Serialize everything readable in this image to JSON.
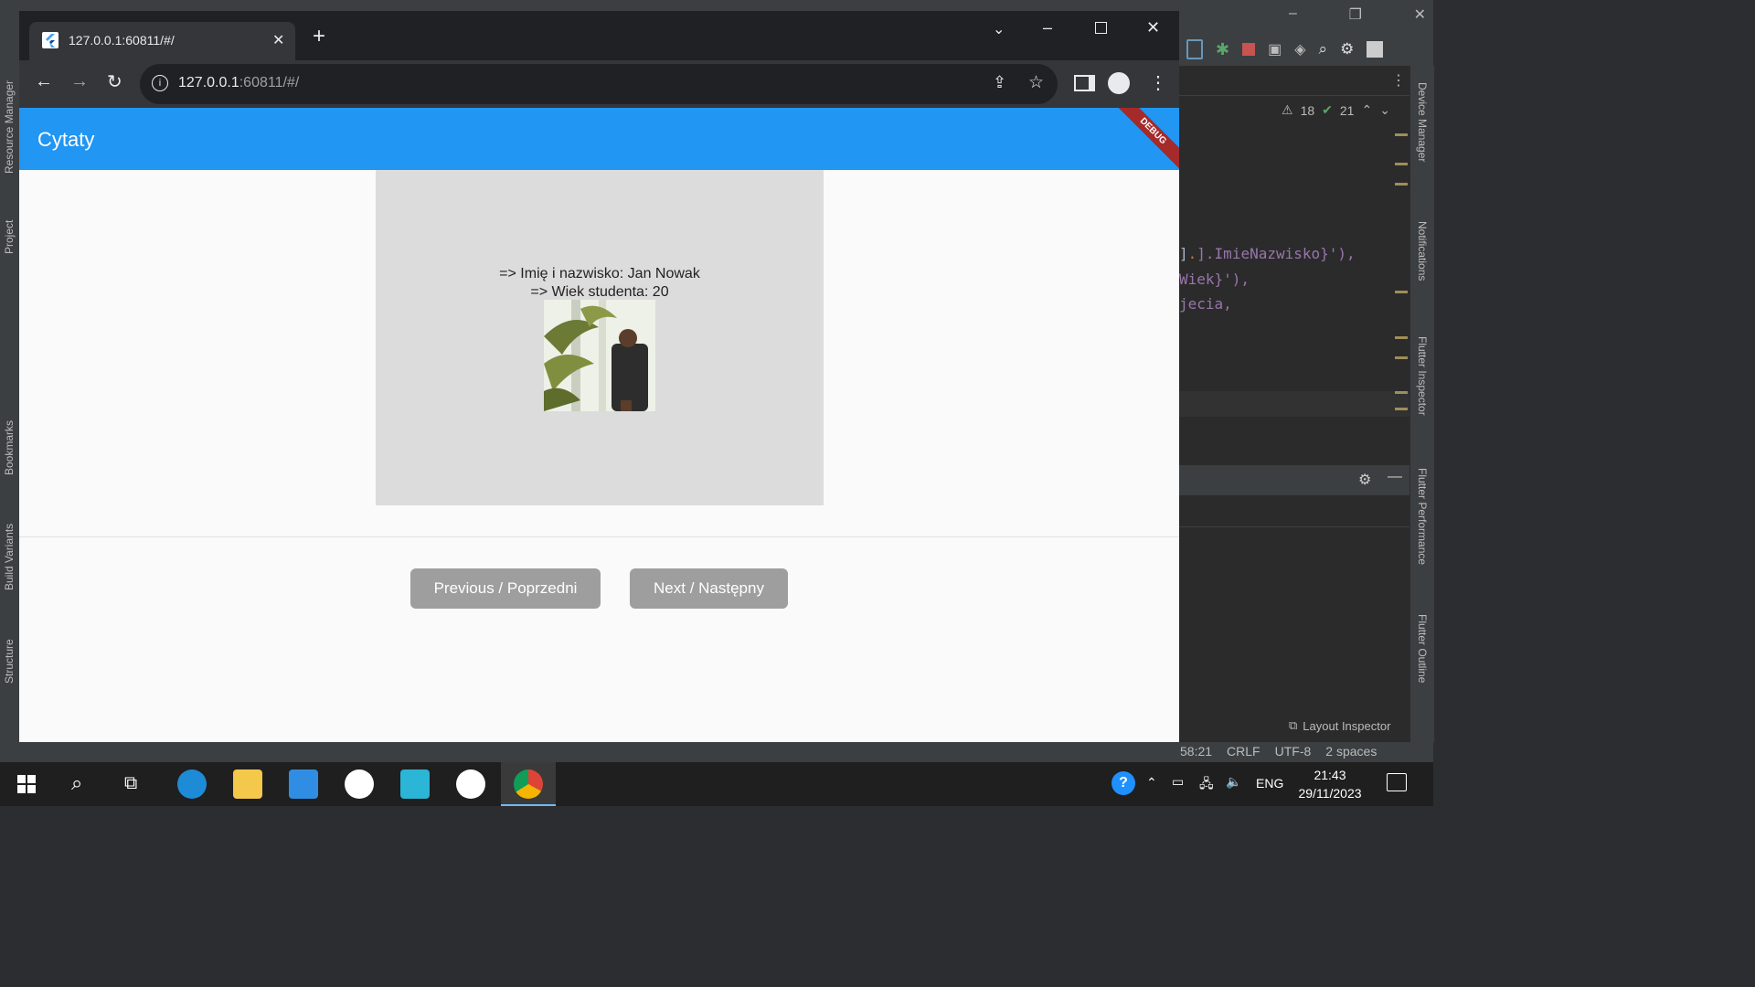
{
  "browser": {
    "tab_title": "127.0.0.1:60811/#/",
    "url_host": "127.0.0.1",
    "url_rest": ":60811/#/"
  },
  "app": {
    "title": "Cytaty",
    "debug_banner": "DEBUG",
    "name_line": "=> Imię i nazwisko: Jan Nowak",
    "age_line": "=> Wiek studenta: 20",
    "prev_label": "Previous / Poprzedni",
    "next_label": "Next / Następny"
  },
  "ide": {
    "left_panels": [
      "Resource Manager",
      "Project",
      "Bookmarks",
      "Build Variants",
      "Structure"
    ],
    "right_panels": [
      "Device Manager",
      "Notifications",
      "Flutter Inspector",
      "Flutter Performance",
      "Flutter Outline"
    ],
    "warnings": "18",
    "checks": "21",
    "code_lines": [
      "].ImieNazwisko}'),",
      "Wiek}'),",
      "jecia,"
    ],
    "layout_inspector": "Layout Inspector",
    "status": {
      "position": "58:21",
      "line_sep": "CRLF",
      "encoding": "UTF-8",
      "indent": "2 spaces"
    }
  },
  "taskbar": {
    "lang": "ENG",
    "time": "21:43",
    "date": "29/11/2023"
  },
  "colors": {
    "appbar": "#2196f3",
    "button": "#9e9e9e",
    "debug": "#a52a2a"
  }
}
